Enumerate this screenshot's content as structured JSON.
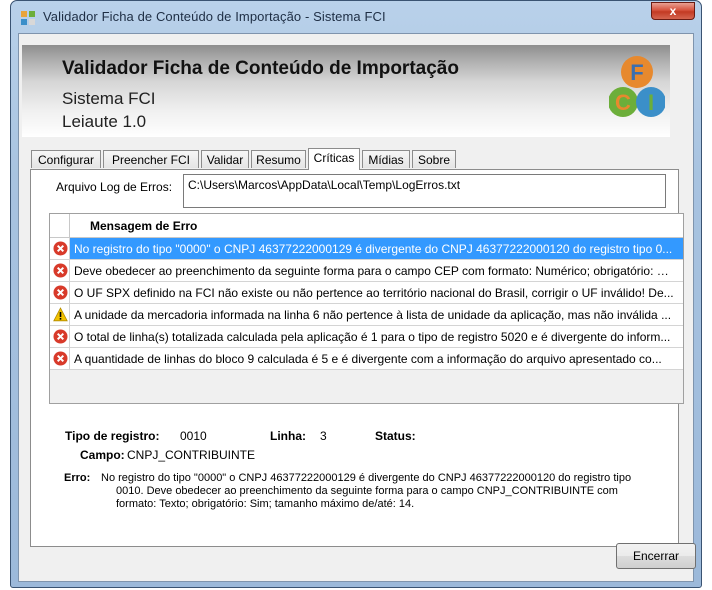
{
  "window": {
    "title": "Validador Ficha de Conteúdo de Importação - Sistema FCI",
    "close_glyph": "x"
  },
  "header": {
    "title": "Validador Ficha de Conteúdo de Importação",
    "subtitle": "Sistema FCI",
    "layout_version": "Leiaute 1.0",
    "logo_letters": [
      "F",
      "C",
      "I"
    ]
  },
  "tabs": [
    {
      "label": "Configurar"
    },
    {
      "label": "Preencher FCI"
    },
    {
      "label": "Validar"
    },
    {
      "label": "Resumo"
    },
    {
      "label": "Críticas",
      "active": true
    },
    {
      "label": "Mídias"
    },
    {
      "label": "Sobre"
    }
  ],
  "log": {
    "label": "Arquivo Log de Erros:",
    "value": "C:\\Users\\Marcos\\AppData\\Local\\Temp\\LogErros.txt"
  },
  "grid": {
    "column_header": "Mensagem de Erro",
    "rows": [
      {
        "icon": "error-icon",
        "text": "No registro do tipo \"0000\" o CNPJ 46377222000129 é divergente do CNPJ 46377222000120 do registro tipo 0...",
        "selected": true
      },
      {
        "icon": "error-icon",
        "text": "Deve obedecer ao preenchimento da seguinte forma para o campo CEP com formato: Numérico; obrigatório: Si..."
      },
      {
        "icon": "error-icon",
        "text": "O UF SPX definido na FCI não existe ou não pertence ao território nacional do Brasil, corrigir o UF inválido! De..."
      },
      {
        "icon": "warning-icon",
        "text": "A unidade da mercadoria informada na linha 6 não pertence à lista de unidade da aplicação, mas não inválida ..."
      },
      {
        "icon": "error-icon",
        "text": "O total de linha(s) totalizada calculada pela aplicação é 1 para o tipo de registro 5020 e é divergente do inform..."
      },
      {
        "icon": "error-icon",
        "text": "A quantidade de linhas do bloco 9 calculada é 5 e é divergente com a informação do arquivo apresentado co..."
      }
    ]
  },
  "details": {
    "tipo_label": "Tipo de registro:",
    "tipo_value": "0010",
    "linha_label": "Linha:",
    "linha_value": "3",
    "status_label": "Status:",
    "status_value": "",
    "campo_label": "Campo:",
    "campo_value": "CNPJ_CONTRIBUINTE",
    "erro_label": "Erro:",
    "erro_lines": [
      "No registro do tipo \"0000\" o CNPJ 46377222000129 é divergente do CNPJ 46377222000120 do registro tipo",
      "0010. Deve obedecer ao preenchimento da seguinte forma para o campo CNPJ_CONTRIBUINTE com",
      "formato: Texto; obrigatório: Sim; tamanho máximo de/até: 14."
    ]
  },
  "buttons": {
    "close_label": "Encerrar"
  },
  "colors": {
    "selection": "#3399ff",
    "error": "#d83a2a",
    "warning": "#f2c200",
    "logo_orange": "#e7892e",
    "logo_blue": "#3b8fc9",
    "logo_green": "#6cae3a"
  }
}
